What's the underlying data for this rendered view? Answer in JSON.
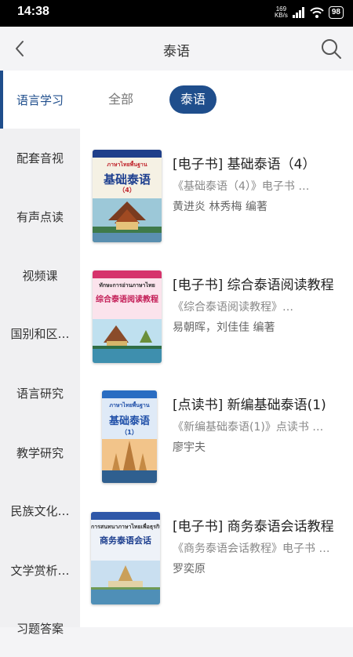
{
  "status_bar": {
    "time": "14:38",
    "net_speed_value": "169",
    "net_speed_unit": "KB/s",
    "battery": "98"
  },
  "header": {
    "title": "泰语",
    "back_icon": "chevron-left-icon",
    "search_icon": "search-icon"
  },
  "sidebar": {
    "items": [
      {
        "label": "语言学习",
        "active": true
      },
      {
        "label": "配套音视",
        "active": false
      },
      {
        "label": "有声点读",
        "active": false
      },
      {
        "label": "视频课",
        "active": false
      },
      {
        "label": "国别和区…",
        "active": false
      },
      {
        "label": "语言研究",
        "active": false
      },
      {
        "label": "教学研究",
        "active": false
      },
      {
        "label": "民族文化…",
        "active": false
      },
      {
        "label": "文学赏析…",
        "active": false
      },
      {
        "label": "习题答案",
        "active": false
      }
    ]
  },
  "filters": {
    "tabs": [
      {
        "label": "全部",
        "selected": false
      },
      {
        "label": "泰语",
        "selected": true
      }
    ]
  },
  "books": [
    {
      "title": "[电子书] 基础泰语（4）",
      "desc": "《基础泰语（4）》电子书 …",
      "author": "黄进炎  林秀梅  编著",
      "cover": {
        "thai": "ภาษาไทยพื้นฐาน",
        "title": "基础泰语",
        "sub": "（4）",
        "band": "#1f3f8a",
        "bg": "#f5f1e4",
        "title_color": "#1d3f8f",
        "thai_color": "#c0262d"
      }
    },
    {
      "title": "[电子书] 综合泰语阅读教程",
      "desc": "《综合泰语阅读教程》…",
      "author": "易朝晖，刘佳佳  编著",
      "cover": {
        "thai": "ทักษะการอ่านภาษาไทย",
        "title": "综合泰语阅读教程",
        "sub": "",
        "band": "#d6336c",
        "bg": "#fbe3ec",
        "title_color": "#c41f58",
        "thai_color": "#2a2a2a"
      }
    },
    {
      "title": "[点读书] 新编基础泰语(1)",
      "desc": "《新编基础泰语(1)》点读书 …",
      "author": "廖宇夫",
      "cover": {
        "thai": "ภาษาไทยพื้นฐาน",
        "title": "基础泰语",
        "sub": "（1）",
        "band": "#2a6dc2",
        "bg": "#dfeaf7",
        "title_color": "#1f4fa8",
        "thai_color": "#1f4fa8"
      }
    },
    {
      "title": "[电子书] 商务泰语会话教程",
      "desc": "《商务泰语会话教程》电子书 …",
      "author": "罗奕原",
      "cover": {
        "thai": "การสนทนาภาษาไทยเพื่อธุรกิจ",
        "title": "商务泰语会话",
        "sub": "",
        "band": "#2e57a8",
        "bg": "#eef2f8",
        "title_color": "#1d3f8f",
        "thai_color": "#333333"
      }
    }
  ],
  "colors": {
    "accent": "#1f4e8c",
    "background": "#f4f4f6"
  }
}
